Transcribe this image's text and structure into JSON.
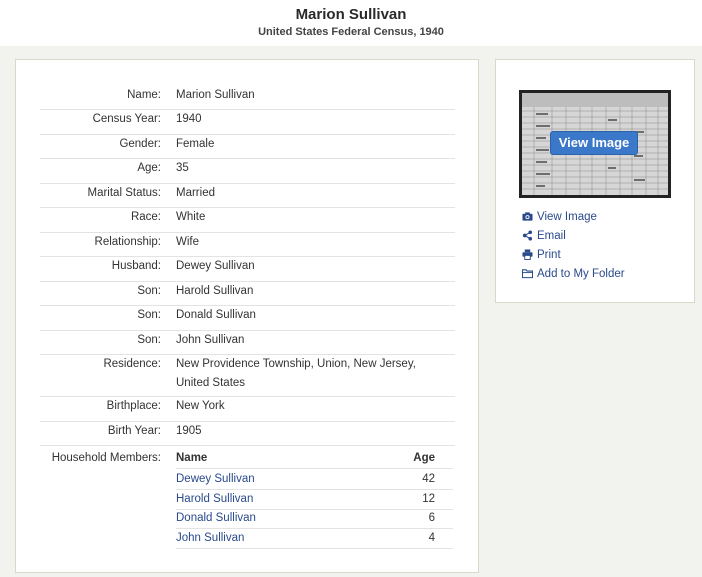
{
  "header": {
    "title": "Marion Sullivan",
    "subtitle": "United States Federal Census, 1940"
  },
  "record": {
    "rows": [
      {
        "label": "Name:",
        "value": "Marion Sullivan"
      },
      {
        "label": "Census Year:",
        "value": "1940"
      },
      {
        "label": "Gender:",
        "value": "Female"
      },
      {
        "label": "Age:",
        "value": "35"
      },
      {
        "label": "Marital Status:",
        "value": "Married"
      },
      {
        "label": "Race:",
        "value": "White"
      },
      {
        "label": "Relationship:",
        "value": "Wife"
      },
      {
        "label": "Husband:",
        "value": "Dewey Sullivan"
      },
      {
        "label": "Son:",
        "value": "Harold Sullivan"
      },
      {
        "label": "Son:",
        "value": "Donald Sullivan"
      },
      {
        "label": "Son:",
        "value": "John Sullivan"
      },
      {
        "label": "Residence:",
        "value": "New Providence Township, Union, New Jersey, United States"
      },
      {
        "label": "Birthplace:",
        "value": "New York"
      },
      {
        "label": "Birth Year:",
        "value": "1905"
      }
    ]
  },
  "household": {
    "label": "Household Members:",
    "col_name": "Name",
    "col_age": "Age",
    "members": [
      {
        "name": "Dewey Sullivan",
        "age": "42"
      },
      {
        "name": "Harold Sullivan",
        "age": "12"
      },
      {
        "name": "Donald Sullivan",
        "age": "6"
      },
      {
        "name": "John Sullivan",
        "age": "4"
      }
    ]
  },
  "sidebar": {
    "view_image_button": "View Image",
    "actions": [
      {
        "label": "View Image",
        "icon": "camera-icon"
      },
      {
        "label": "Email",
        "icon": "share-icon"
      },
      {
        "label": "Print",
        "icon": "print-icon"
      },
      {
        "label": "Add to My Folder",
        "icon": "folder-icon"
      }
    ]
  },
  "colors": {
    "link": "#2a4a8c",
    "button": "#3b78c9",
    "panel_border": "#d9d9c9"
  }
}
